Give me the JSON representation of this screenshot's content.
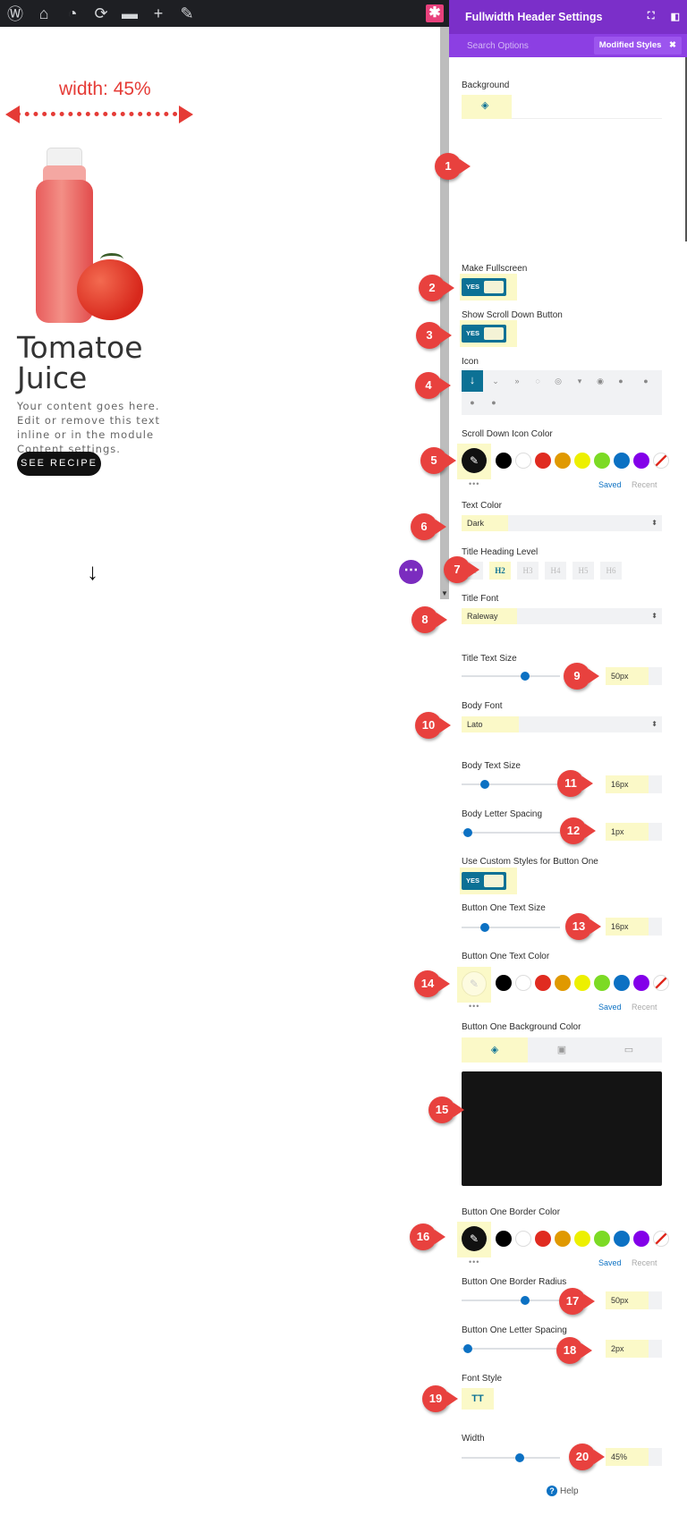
{
  "adminbar": {
    "icons": [
      "wordpress-icon",
      "my-sites-icon",
      "dashboard-icon",
      "updates-icon",
      "comments-icon",
      "new-icon",
      "edit-icon"
    ],
    "divi_button": "✱"
  },
  "preview": {
    "width_label": "width: 45%",
    "title": "Tomatoe Juice",
    "body": "Your content goes here. Edit or remove this text inline or in the module Content settings.",
    "button": "SEE RECIPE",
    "scroll_icon": "↓",
    "dots_icon": "⋯"
  },
  "panel": {
    "title": "Fullwidth Header Settings",
    "tab_search": "Search Options",
    "tab_modified": "Modified Styles",
    "tab_close": "✖",
    "labels": {
      "background": "Background",
      "make_fullscreen": "Make Fullscreen",
      "show_scroll": "Show Scroll Down Button",
      "icon": "Icon",
      "scroll_icon_color": "Scroll Down Icon Color",
      "text_color": "Text Color",
      "title_heading_level": "Title Heading Level",
      "title_font": "Title Font",
      "title_text_size": "Title Text Size",
      "body_font": "Body Font",
      "body_text_size": "Body Text Size",
      "body_letter_spacing": "Body Letter Spacing",
      "custom_button": "Use Custom Styles for Button One",
      "btn_text_size": "Button One Text Size",
      "btn_text_color": "Button One Text Color",
      "btn_bg_color": "Button One Background Color",
      "btn_border_color": "Button One Border Color",
      "btn_border_radius": "Button One Border Radius",
      "btn_letter_spacing": "Button One Letter Spacing",
      "font_style": "Font Style",
      "width": "Width"
    },
    "toggle_yes": "YES",
    "icon_selected": "↓",
    "saved": "Saved",
    "recent": "Recent",
    "more_dots": "•••",
    "text_color_value": "Dark",
    "heading_levels": [
      "H1",
      "H2",
      "H3",
      "H4",
      "H5",
      "H6"
    ],
    "heading_selected": "H2",
    "title_font_value": "Raleway",
    "body_font_value": "Lato",
    "values": {
      "title_text_size": "50px",
      "body_text_size": "16px",
      "body_letter_spacing": "1px",
      "btn_text_size": "16px",
      "btn_border_radius": "50px",
      "btn_letter_spacing": "2px",
      "width": "45%"
    },
    "slider_levels": {
      "title_text_size": 0.6,
      "body_text_size": 0.2,
      "body_letter_spacing": 0.05,
      "btn_text_size": 0.2,
      "btn_border_radius": 0.6,
      "btn_letter_spacing": 0.05,
      "width": 0.53
    },
    "font_style_value": "TT",
    "help": "Help",
    "swatch_colors": [
      "#000000",
      "#ffffff",
      "#e02b20",
      "#e09900",
      "#edf000",
      "#7cda24",
      "#0c71c3",
      "#8300e9"
    ]
  },
  "markers": [
    "1",
    "2",
    "3",
    "4",
    "5",
    "6",
    "7",
    "8",
    "9",
    "10",
    "11",
    "12",
    "13",
    "14",
    "15",
    "16",
    "17",
    "18",
    "19",
    "20"
  ]
}
